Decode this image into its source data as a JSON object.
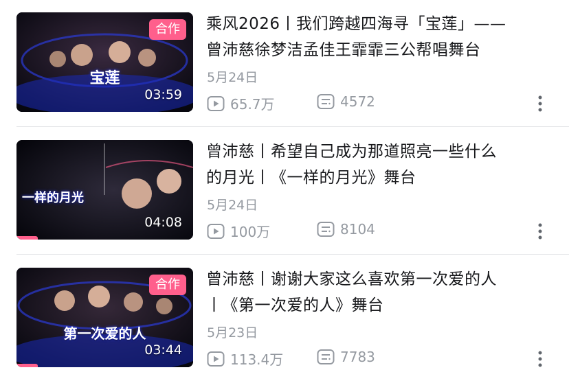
{
  "videos": [
    {
      "title_line1": "乘风2026丨我们跨越四海寻「宝莲」——",
      "title_line2": "曾沛慈徐梦洁孟佳王霏霏三公帮唱舞台",
      "date": "5月24日",
      "views": "65.7万",
      "comments": "4572",
      "duration": "03:59",
      "badge": "合作",
      "thumb_text": "宝莲",
      "progress": 0
    },
    {
      "title_line1": "曾沛慈丨希望自己成为那道照亮一些什么",
      "title_line2": "的月光丨《一样的月光》舞台",
      "date": "5月24日",
      "views": "100万",
      "comments": "8104",
      "duration": "04:08",
      "badge": "",
      "thumb_text": "一样的月光",
      "progress": 0.12
    },
    {
      "title_line1": "曾沛慈丨谢谢大家这么喜欢第一次爱的人",
      "title_line2": "丨《第一次爱的人》舞台",
      "date": "5月23日",
      "views": "113.4万",
      "comments": "7783",
      "duration": "03:44",
      "badge": "合作",
      "thumb_text": "第一次爱的人",
      "progress": 0.12
    }
  ],
  "icons": {
    "views": "play-count-icon",
    "comments": "danmaku-count-icon",
    "more": "more-options-icon"
  },
  "colors": {
    "accent": "#ff5f8c",
    "meta_text": "#9499a0",
    "title_text": "#18191c"
  }
}
